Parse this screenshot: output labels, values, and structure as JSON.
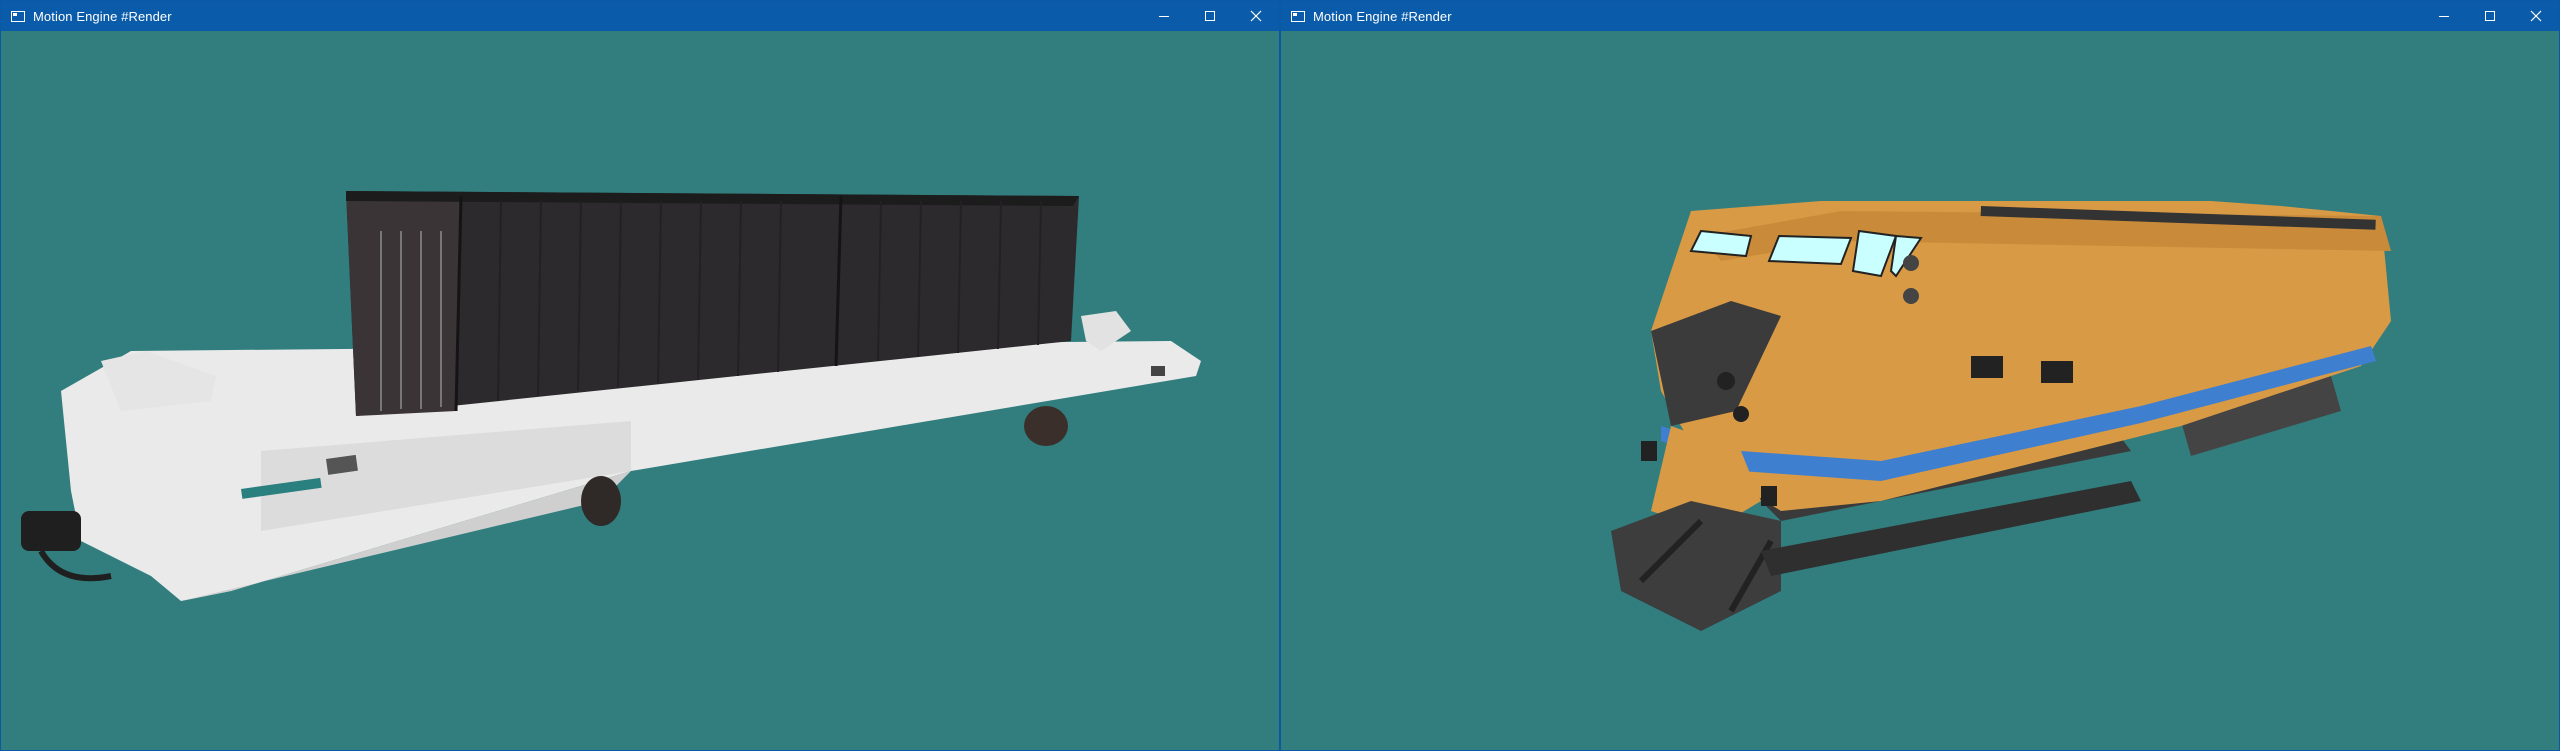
{
  "windows": [
    {
      "title": "Motion Engine #Render",
      "scene": "flatcar-with-container"
    },
    {
      "title": "Motion Engine #Render",
      "scene": "locomotive"
    }
  ],
  "colors": {
    "titlebar": "#0a5cab",
    "viewport_bg": "#327e7e",
    "locomotive_body": "#d99a45",
    "locomotive_stripe": "#3f7fcf",
    "container": "#2c2a2c",
    "flatcar": "#f0f0f0"
  },
  "icons": [
    "app-icon",
    "minimize-icon",
    "maximize-icon",
    "close-icon"
  ]
}
